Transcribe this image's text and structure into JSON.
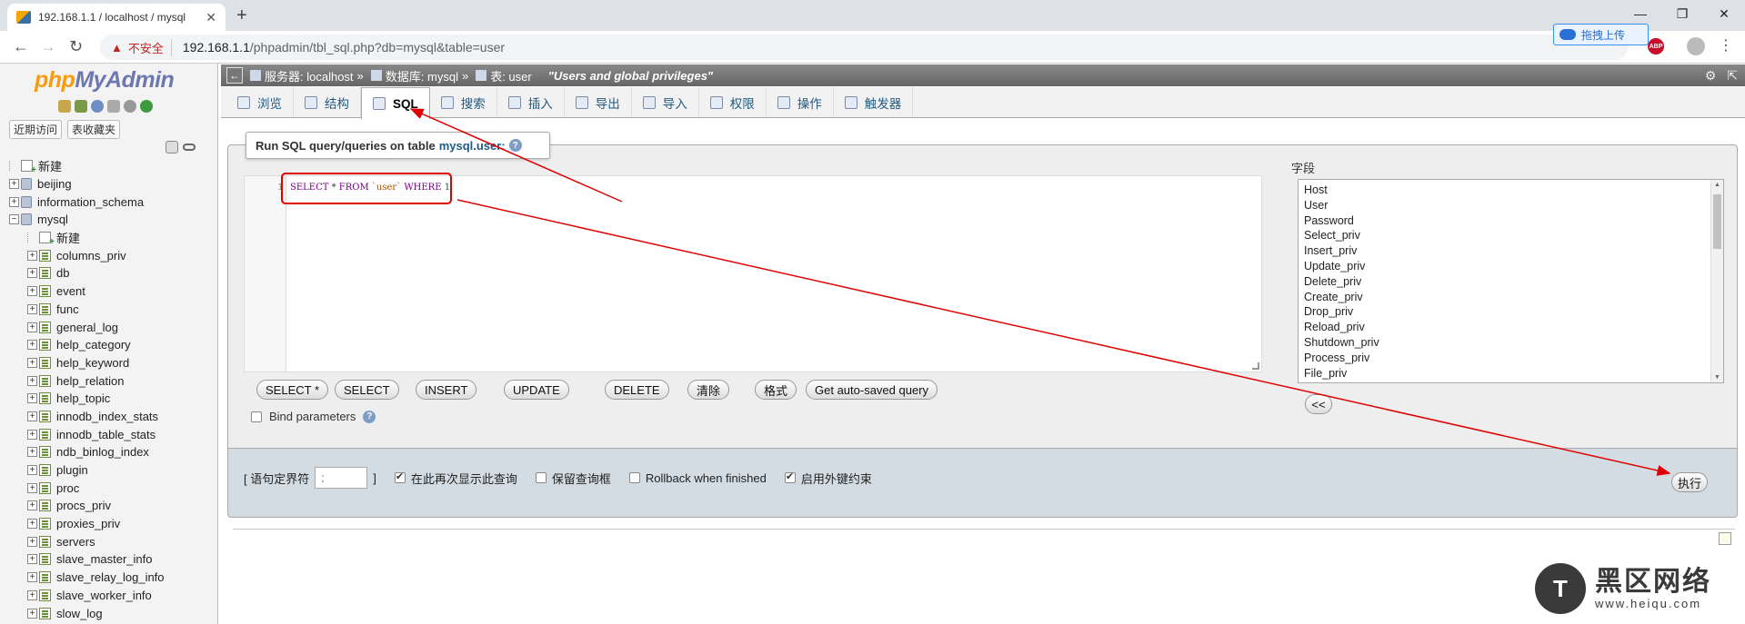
{
  "browser": {
    "tab_title": "192.168.1.1 / localhost / mysql",
    "new_tab": "+",
    "insecure_label": "不安全",
    "url_host": "192.168.1.1",
    "url_path": "/phpadmin/tbl_sql.php?db=mysql&table=user",
    "baidu_label": "拖拽上传",
    "abp_label": "ABP"
  },
  "nav": {
    "logo_php": "php",
    "logo_myadmin": "MyAdmin",
    "tab_recent": "近期访问",
    "tab_favorites": "表收藏夹",
    "tree": [
      {
        "label": "新建",
        "kind": "new",
        "level": 1
      },
      {
        "label": "beijing",
        "kind": "db",
        "level": 1
      },
      {
        "label": "information_schema",
        "kind": "db",
        "level": 1
      },
      {
        "label": "mysql",
        "kind": "db",
        "level": 1
      },
      {
        "label": "新建",
        "kind": "new",
        "level": 2
      },
      {
        "label": "columns_priv",
        "kind": "table",
        "level": 2
      },
      {
        "label": "db",
        "kind": "table",
        "level": 2
      },
      {
        "label": "event",
        "kind": "table",
        "level": 2
      },
      {
        "label": "func",
        "kind": "table",
        "level": 2
      },
      {
        "label": "general_log",
        "kind": "table",
        "level": 2
      },
      {
        "label": "help_category",
        "kind": "table",
        "level": 2
      },
      {
        "label": "help_keyword",
        "kind": "table",
        "level": 2
      },
      {
        "label": "help_relation",
        "kind": "table",
        "level": 2
      },
      {
        "label": "help_topic",
        "kind": "table",
        "level": 2
      },
      {
        "label": "innodb_index_stats",
        "kind": "table",
        "level": 2
      },
      {
        "label": "innodb_table_stats",
        "kind": "table",
        "level": 2
      },
      {
        "label": "ndb_binlog_index",
        "kind": "table",
        "level": 2
      },
      {
        "label": "plugin",
        "kind": "table",
        "level": 2
      },
      {
        "label": "proc",
        "kind": "table",
        "level": 2
      },
      {
        "label": "procs_priv",
        "kind": "table",
        "level": 2
      },
      {
        "label": "proxies_priv",
        "kind": "table",
        "level": 2
      },
      {
        "label": "servers",
        "kind": "table",
        "level": 2
      },
      {
        "label": "slave_master_info",
        "kind": "table",
        "level": 2
      },
      {
        "label": "slave_relay_log_info",
        "kind": "table",
        "level": 2
      },
      {
        "label": "slave_worker_info",
        "kind": "table",
        "level": 2
      },
      {
        "label": "slow_log",
        "kind": "table",
        "level": 2
      }
    ]
  },
  "breadcrumb": {
    "server": "服务器: localhost",
    "database": "数据库: mysql",
    "table": "表: user",
    "comment": "\"Users and global privileges\""
  },
  "tabs": [
    {
      "label": "浏览",
      "icon": "browse-icon"
    },
    {
      "label": "结构",
      "icon": "structure-icon"
    },
    {
      "label": "SQL",
      "icon": "sql-icon",
      "active": true
    },
    {
      "label": "搜索",
      "icon": "search-icon"
    },
    {
      "label": "插入",
      "icon": "insert-icon"
    },
    {
      "label": "导出",
      "icon": "export-icon"
    },
    {
      "label": "导入",
      "icon": "import-icon"
    },
    {
      "label": "权限",
      "icon": "privileges-icon"
    },
    {
      "label": "操作",
      "icon": "operations-icon"
    },
    {
      "label": "触发器",
      "icon": "triggers-icon"
    }
  ],
  "sql": {
    "tooltip_prefix": "Run SQL query/queries on table",
    "tooltip_table": "mysql.user:",
    "line_number": "1",
    "q_select": "SELECT",
    "q_star": "*",
    "q_from": "FROM",
    "q_table": "`user`",
    "q_where": "WHERE",
    "q_one": "1",
    "buttons": [
      "SELECT *",
      "SELECT",
      "INSERT",
      "UPDATE",
      "DELETE",
      "清除",
      "格式",
      "Get auto-saved query"
    ],
    "bind_parameters": "Bind parameters"
  },
  "fields": {
    "label": "字段",
    "items": [
      "Host",
      "User",
      "Password",
      "Select_priv",
      "Insert_priv",
      "Update_priv",
      "Delete_priv",
      "Create_priv",
      "Drop_priv",
      "Reload_priv",
      "Shutdown_priv",
      "Process_priv",
      "File_priv"
    ],
    "insert_button": "<<"
  },
  "footer": {
    "delimiter_open": "[ 语句定界符",
    "delimiter_value": ";",
    "delimiter_close": "]",
    "show_again": "在此再次显示此查询",
    "retain_box": "保留查询框",
    "rollback": "Rollback when finished",
    "foreign_keys": "启用外键约束",
    "go_button": "执行"
  },
  "watermark": {
    "glyph": "T",
    "title": "黑区网络",
    "url": "www.heiqu.com"
  },
  "colors": {
    "annotation": "#e00000",
    "link": "#235a81"
  }
}
